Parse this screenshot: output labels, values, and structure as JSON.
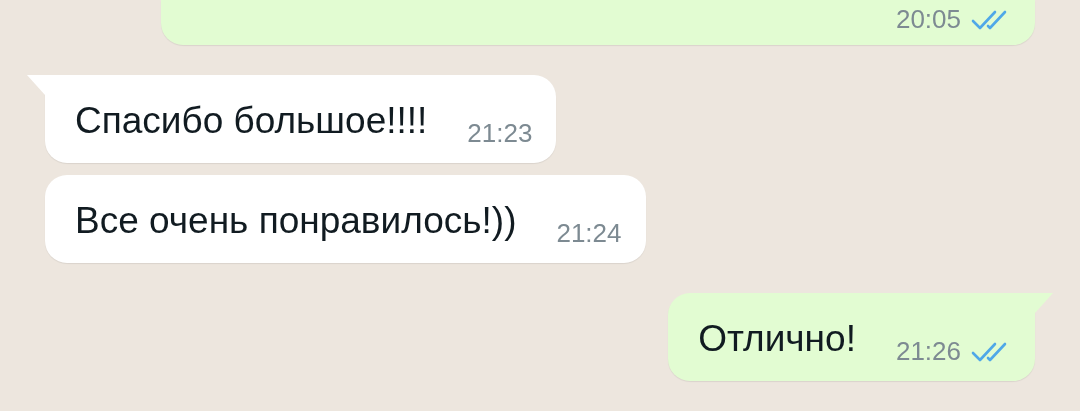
{
  "messages": [
    {
      "kind": "outgoing",
      "time": "20:05",
      "read": true,
      "tail": false
    },
    {
      "kind": "incoming",
      "text": "Спасибо большое!!!!",
      "time": "21:23",
      "tail": true
    },
    {
      "kind": "incoming",
      "text": "Все очень понравилось!))",
      "time": "21:24",
      "tail": false
    },
    {
      "kind": "outgoing",
      "text": "Отлично!",
      "time": "21:26",
      "read": true,
      "tail": true
    }
  ]
}
